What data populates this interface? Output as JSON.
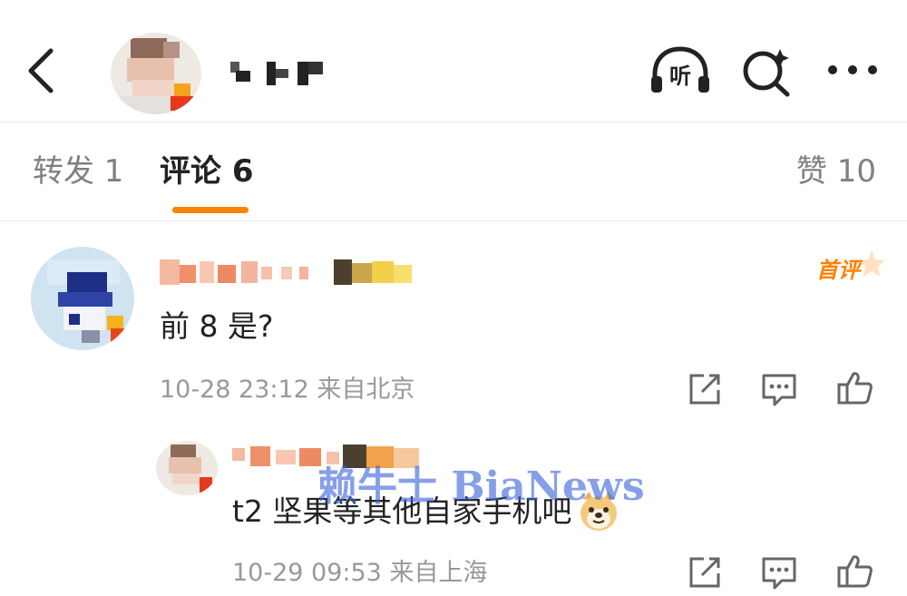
{
  "header": {
    "back_icon": "chevron-left-icon",
    "listen_label": "听",
    "search_icon": "search-sparkle-icon",
    "more_icon": "more-dots-icon"
  },
  "tabs": [
    {
      "label": "转发 1",
      "active": false
    },
    {
      "label": "评论 6",
      "active": true
    },
    {
      "label": "赞 10",
      "active": false
    }
  ],
  "accent_color": "#ff8200",
  "comments": [
    {
      "text": "前 8 是?",
      "meta": "10-28 23:12 来自北京",
      "badge": "首评"
    },
    {
      "text": "t2 坚果等其他自家手机吧",
      "emoji": "doge-emoji",
      "meta": "10-29 09:53 来自上海"
    }
  ],
  "watermark": "赖牛士 BiaNews"
}
